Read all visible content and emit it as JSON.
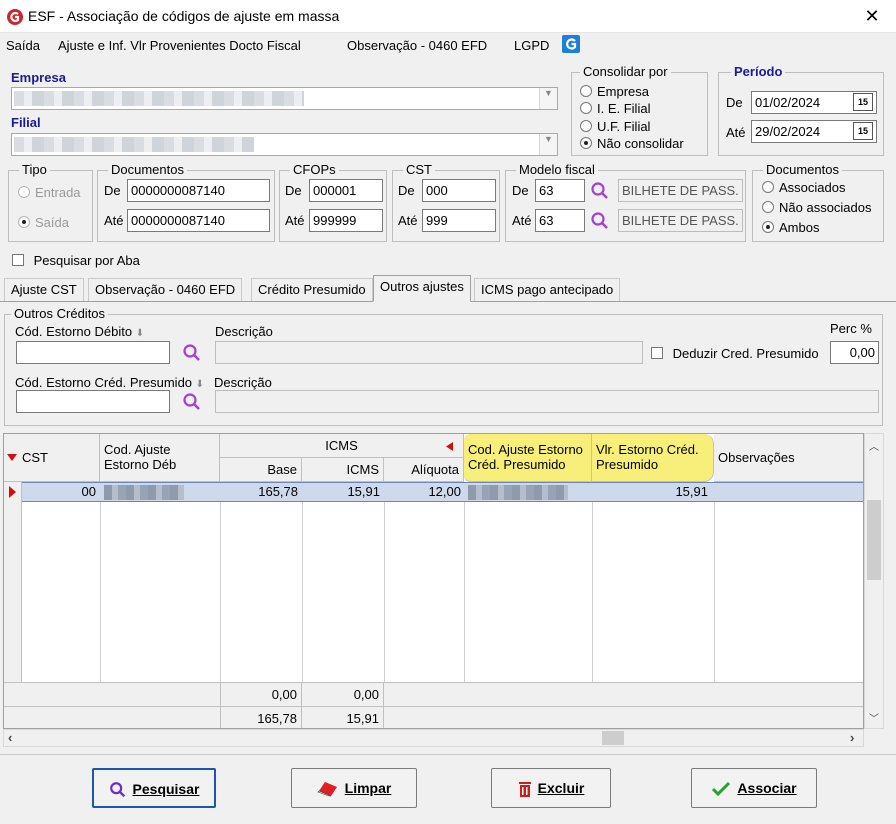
{
  "window": {
    "title": "ESF - Associação de códigos de ajuste em massa",
    "close": "✕"
  },
  "menu": [
    "Saída",
    "Ajuste e Inf. Vlr Provenientes Docto Fiscal",
    "Observação - 0460 EFD",
    "LGPD"
  ],
  "empresa": {
    "label": "Empresa"
  },
  "filial": {
    "label": "Filial"
  },
  "consolidar": {
    "title": "Consolidar por",
    "options": [
      "Empresa",
      "I. E. Filial",
      "U.F. Filial",
      "Não consolidar"
    ],
    "selected": "Não consolidar"
  },
  "periodo": {
    "title": "Período",
    "de_label": "De",
    "de": "01/02/2024",
    "ate_label": "Até",
    "ate": "29/02/2024",
    "cal": "15"
  },
  "tipo": {
    "title": "Tipo",
    "options": [
      "Entrada",
      "Saída"
    ],
    "selected": "Saída"
  },
  "documentos": {
    "title": "Documentos",
    "de_label": "De",
    "de": "0000000087140",
    "ate_label": "Até",
    "ate": "0000000087140"
  },
  "cfops": {
    "title": "CFOPs",
    "de_label": "De",
    "de": "000001",
    "ate_label": "Até",
    "ate": "999999"
  },
  "cst": {
    "title": "CST",
    "de_label": "De",
    "de": "000",
    "ate_label": "Até",
    "ate": "999"
  },
  "modelo": {
    "title": "Modelo fiscal",
    "de_label": "De",
    "de": "63",
    "de_desc": "BILHETE DE PASS.",
    "ate_label": "Até",
    "ate": "63",
    "ate_desc": "BILHETE DE PASS."
  },
  "documentos_assoc": {
    "title": "Documentos",
    "options": [
      "Associados",
      "Não associados",
      "Ambos"
    ],
    "selected": "Ambos"
  },
  "pesquisar_aba": {
    "label": "Pesquisar por Aba"
  },
  "tabs": [
    "Ajuste CST",
    "Observação - 0460 EFD",
    "Crédito Presumido",
    "Outros ajustes",
    "ICMS pago antecipado"
  ],
  "active_tab": "Outros ajustes",
  "outros": {
    "title": "Outros Créditos",
    "cod_debito_label": "Cód. Estorno Débito",
    "descricao_label": "Descrição",
    "perc_label": "Perc %",
    "perc": "0,00",
    "deduzir_label": "Deduzir Cred. Presumido",
    "cod_presumido_label": "Cód. Estorno Créd. Presumido",
    "descricao2_label": "Descrição"
  },
  "grid": {
    "headers": {
      "cst": "CST",
      "cod_ajuste": "Cod. Ajuste Estorno Déb",
      "icms_group": "ICMS",
      "base": "Base",
      "icms": "ICMS",
      "aliquota": "Alíquota",
      "cod_estorno_presumido": "Cod. Ajuste Estorno Créd. Presumido",
      "vlr_estorno": "Vlr. Estorno Créd. Presumido",
      "observacoes": "Observações"
    },
    "rows": [
      {
        "cst": "00",
        "base": "165,78",
        "icms": "15,91",
        "aliquota": "12,00",
        "vlr_estorno": "15,91"
      }
    ],
    "footer1": {
      "base": "0,00",
      "icms": "0,00"
    },
    "footer2": {
      "base": "165,78",
      "icms": "15,91"
    }
  },
  "buttons": {
    "pesquisar": "Pesquisar",
    "limpar": "Limpar",
    "excluir": "Excluir",
    "associar": "Associar"
  },
  "colors": {
    "accent_blue": "#1b56b4",
    "title_blue": "#1a1a9c",
    "highlight_yellow": "#f7ef7a",
    "selection": "#cfd9ec",
    "row_marker": "#d01010"
  }
}
